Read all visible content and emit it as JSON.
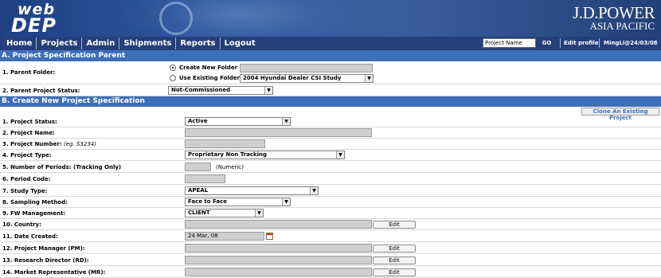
{
  "branding": {
    "app_logo_top": "web",
    "app_logo_bottom": "DEP",
    "company_line1": "J.D.POWER",
    "company_line2": "ASIA PACIFIC"
  },
  "nav": {
    "items": [
      "Home",
      "Projects",
      "Admin",
      "Shipments",
      "Reports",
      "Logout"
    ]
  },
  "header_tools": {
    "project_search_value": "Project Name",
    "go_label": "GO",
    "edit_profile_label": "Edit profile",
    "user_info": "MingLi@24/03/08"
  },
  "section_a": {
    "title": "A. Project Specification Parent",
    "parent_folder_label": "1. Parent Folder:",
    "create_new_folder_label": "Create New Folder",
    "use_existing_folder_label": "Use Existing Folder",
    "existing_folder_value": "2004 Hyundai Dealer CSI Study",
    "parent_status_label": "2. Parent Project Status:",
    "parent_status_value": "Not-Commissioned"
  },
  "section_b": {
    "title": "B. Create New Project Specification",
    "clone_label": "Clone An Existing Project",
    "fields": {
      "project_status": {
        "label": "1. Project Status:",
        "value": "Active"
      },
      "project_name": {
        "label": "2. Project Name:"
      },
      "project_number": {
        "label": "3. Project Number:",
        "note": "(eg. S3234)"
      },
      "project_type": {
        "label": "4. Project Type:",
        "value": "Proprietary Non Tracking"
      },
      "periods": {
        "label": "5. Number of Periods: (Tracking Only)",
        "hint": "(Numeric)"
      },
      "period_code": {
        "label": "6. Period Code:"
      },
      "study_type": {
        "label": "7. Study Type:",
        "value": "APEAL"
      },
      "sampling": {
        "label": "8. Sampling Method:",
        "value": "Face to Face"
      },
      "fw_mgmt": {
        "label": "9. FW Management:",
        "value": "CLIENT"
      },
      "country": {
        "label": "10. Country:"
      },
      "date_created": {
        "label": "11. Date Created:",
        "value": "24 Mar, 08"
      },
      "pm": {
        "label": "12. Project Manager (PM):"
      },
      "rd": {
        "label": "13. Research Director (RD):"
      },
      "mr": {
        "label": "14. Market Representative (MR):"
      }
    },
    "edit_label": "Edit"
  }
}
